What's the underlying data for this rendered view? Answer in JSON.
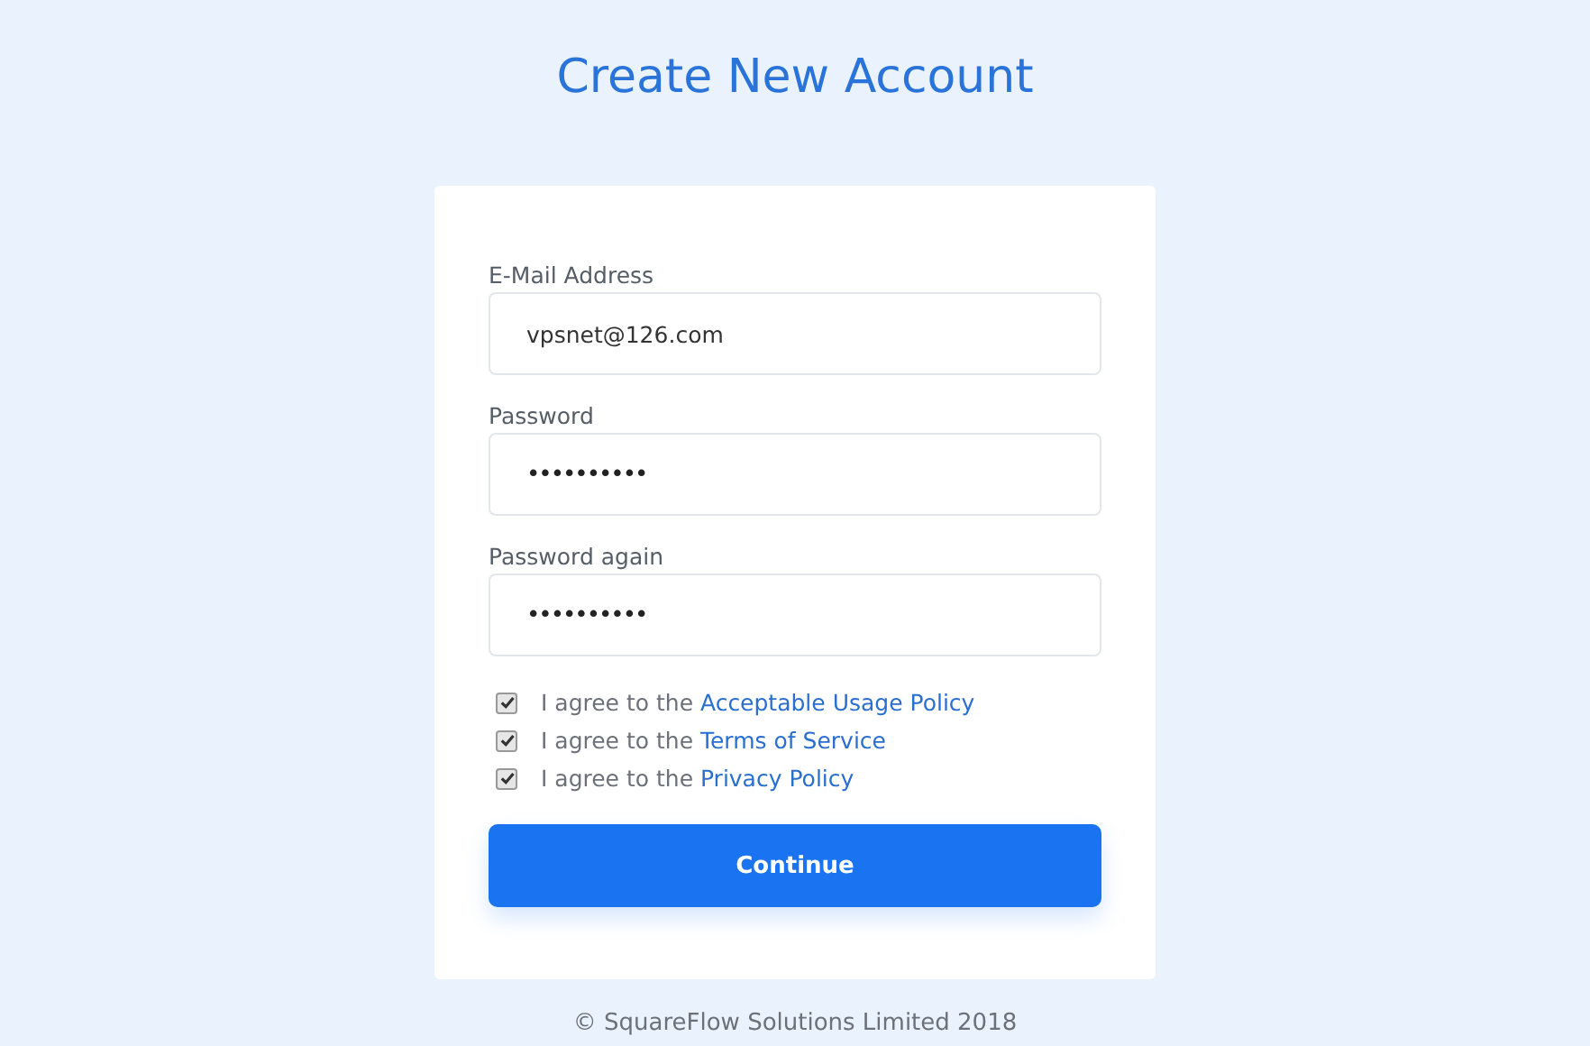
{
  "title": "Create New Account",
  "fields": [
    {
      "label": "E-Mail Address",
      "value": "vpsnet@126.com",
      "kind": "text"
    },
    {
      "label": "Password",
      "value": "••••••••••",
      "kind": "password"
    },
    {
      "label": "Password again",
      "value": "••••••••••",
      "kind": "password"
    }
  ],
  "agreements": [
    {
      "text": "I agree to the ",
      "link": "Acceptable Usage Policy",
      "checked": true
    },
    {
      "text": "I agree to the ",
      "link": "Terms of Service",
      "checked": true
    },
    {
      "text": "I agree to the ",
      "link": "Privacy Policy",
      "checked": true
    }
  ],
  "button": "Continue",
  "footer": "© SquareFlow Solutions Limited 2018"
}
